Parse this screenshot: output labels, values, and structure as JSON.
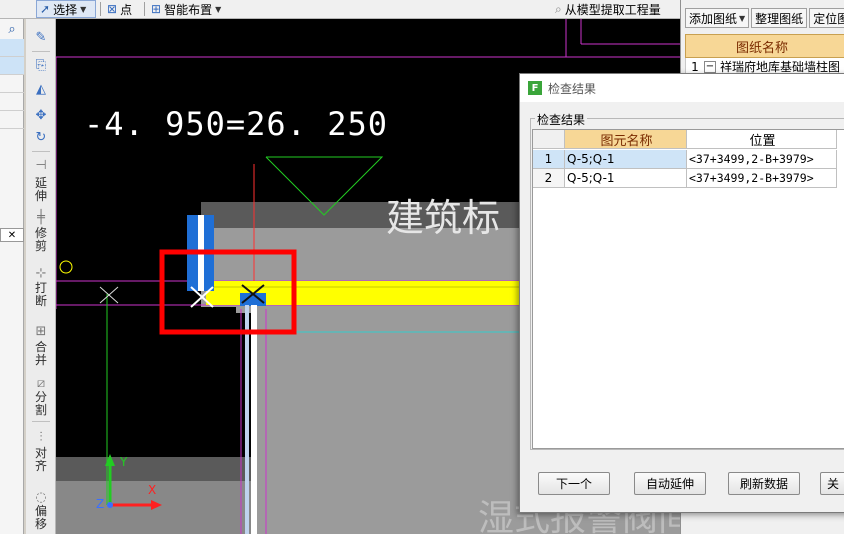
{
  "toolbar": {
    "select_label": "选择",
    "point_label": "点",
    "smart_layout_label": "智能布置",
    "extract_label": "从模型提取工程量"
  },
  "canvas": {
    "elevation_text": "-4. 950=26. 250",
    "building_label": "建筑标",
    "bottom_label": "湿式报警阀间",
    "axis_y": "Y",
    "axis_x": "X",
    "axis_z": "Z"
  },
  "tools": {
    "extend": "延伸",
    "trim": "修剪",
    "break": "打断",
    "merge": "合并",
    "split": "分割",
    "align": "对齐",
    "offset": "偏移"
  },
  "drawings_panel": {
    "buttons": [
      "添加图纸",
      "整理图纸",
      "定位图"
    ],
    "column_header": "图纸名称",
    "rows": [
      {
        "index": "1",
        "toggle": "−",
        "name": "祥瑞府地库基础墙柱图"
      }
    ]
  },
  "dialog": {
    "title": "检查结果",
    "group_label": "检查结果",
    "columns": [
      "图元名称",
      "位置"
    ],
    "rows": [
      {
        "index": "1",
        "name": "Q-5;Q-1",
        "position": "<37+3499,2-B+3979>"
      },
      {
        "index": "2",
        "name": "Q-5;Q-1",
        "position": "<37+3499,2-B+3979>"
      }
    ],
    "buttons": [
      "下一个",
      "自动延伸",
      "刷新数据",
      "关"
    ]
  },
  "colors": {
    "highlight_box": "#ff0000",
    "wall_yellow": "#ffff00",
    "column_blue": "#1f6fd6",
    "grid_header": "#f7d796",
    "magenta_line": "#cc33cc",
    "green_line": "#22cc22"
  }
}
